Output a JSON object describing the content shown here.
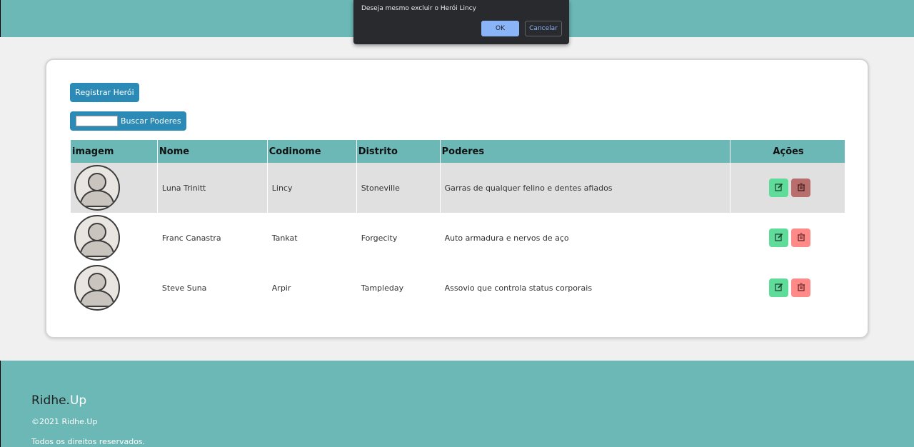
{
  "dialog": {
    "message": "Deseja mesmo excluir o Herói Lincy",
    "ok_label": "OK",
    "cancel_label": "Cancelar"
  },
  "toolbar": {
    "register_label": "Registrar Herói",
    "search_button_label": "Buscar Poderes",
    "search_value": ""
  },
  "table": {
    "headers": {
      "image": "imagem",
      "name": "Nome",
      "codename": "Codinome",
      "district": "Distrito",
      "powers": "Poderes",
      "actions": "Ações"
    },
    "rows": [
      {
        "name": "Luna Trinitt",
        "codename": "Lincy",
        "district": "Stoneville",
        "powers": "Garras de qualquer felino e dentes afiados",
        "selected": true
      },
      {
        "name": "Franc Canastra",
        "codename": "Tankat",
        "district": "Forgecity",
        "powers": "Auto armadura e nervos de aço",
        "selected": false
      },
      {
        "name": "Steve Suna",
        "codename": "Arpir",
        "district": "Tampleday",
        "powers": "Assovio que controla status corporais",
        "selected": false
      }
    ]
  },
  "footer": {
    "brand_a": "Ridhe.",
    "brand_b": "Up",
    "copyright": "©2021 Ridhe.Up",
    "rights": "Todos os direitos reservados."
  },
  "colors": {
    "teal": "#6bb8b7",
    "primary_button": "#2b8ab6",
    "edit_button": "#5fdc99",
    "delete_button": "#ff8a87"
  },
  "icons": {
    "edit": "edit-icon",
    "delete": "trash-icon",
    "avatar": "user-avatar-icon"
  }
}
